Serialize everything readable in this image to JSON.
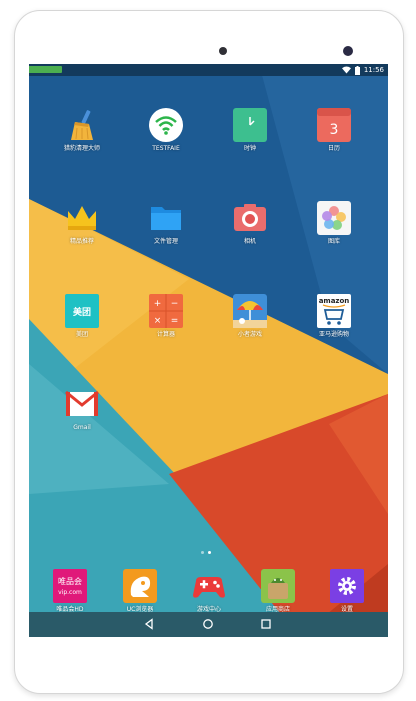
{
  "status_bar": {
    "time": "11:56",
    "left_icons": [
      "image-icon",
      "app-notification-icon"
    ],
    "right_icons": [
      "wifi-icon",
      "battery-icon"
    ]
  },
  "home_apps": [
    {
      "name": "cleaner-app",
      "label": "猎豹清理大师",
      "icon": "broom-icon"
    },
    {
      "name": "testfaie-app",
      "label": "TESTFAIE",
      "icon": "wifi-test-icon"
    },
    {
      "name": "clock-app",
      "label": "时钟",
      "icon": "clock-icon"
    },
    {
      "name": "calendar-app",
      "label": "日历",
      "icon": "calendar-icon",
      "date": "3"
    },
    {
      "name": "recommend-app",
      "label": "精品推荐",
      "icon": "crown-icon"
    },
    {
      "name": "file-manager-app",
      "label": "文件管理",
      "icon": "folder-icon"
    },
    {
      "name": "camera-app",
      "label": "相机",
      "icon": "camera-icon"
    },
    {
      "name": "gallery-app",
      "label": "图库",
      "icon": "gallery-icon"
    },
    {
      "name": "meituan-app",
      "label": "美团",
      "icon": "meituan-icon",
      "brand_text": "美团"
    },
    {
      "name": "calculator-app",
      "label": "计算器",
      "icon": "calculator-icon"
    },
    {
      "name": "mini-games-app",
      "label": "小者游戏",
      "icon": "beach-game-icon"
    },
    {
      "name": "amazon-app",
      "label": "亚马逊购物",
      "icon": "amazon-icon",
      "brand_text": "amazon"
    },
    {
      "name": "gmail-app",
      "label": "Gmail",
      "icon": "gmail-icon"
    }
  ],
  "dock_apps": [
    {
      "name": "vip-app",
      "label": "唯品会HD",
      "icon": "vip-icon",
      "brand_text": [
        "唯品会",
        "vip.com"
      ]
    },
    {
      "name": "uc-browser-app",
      "label": "UC浏览器",
      "icon": "uc-squirrel-icon"
    },
    {
      "name": "game-center-app",
      "label": "游戏中心",
      "icon": "gamepad-icon"
    },
    {
      "name": "app-store-app",
      "label": "应用商店",
      "icon": "android-store-icon"
    },
    {
      "name": "settings-app",
      "label": "设置",
      "icon": "gear-icon"
    }
  ],
  "page_indicator": {
    "pages": 2,
    "current": 2
  },
  "navigation": [
    "back-icon",
    "home-icon",
    "recents-icon"
  ],
  "colors": {
    "wallpaper_blue": "#1d5b93",
    "wallpaper_yellow": "#f2b63c",
    "wallpaper_teal": "#3ba5b6",
    "wallpaper_red": "#d8492a",
    "status_bar": "#133a5c",
    "nav_bar": "#2a5a68"
  }
}
